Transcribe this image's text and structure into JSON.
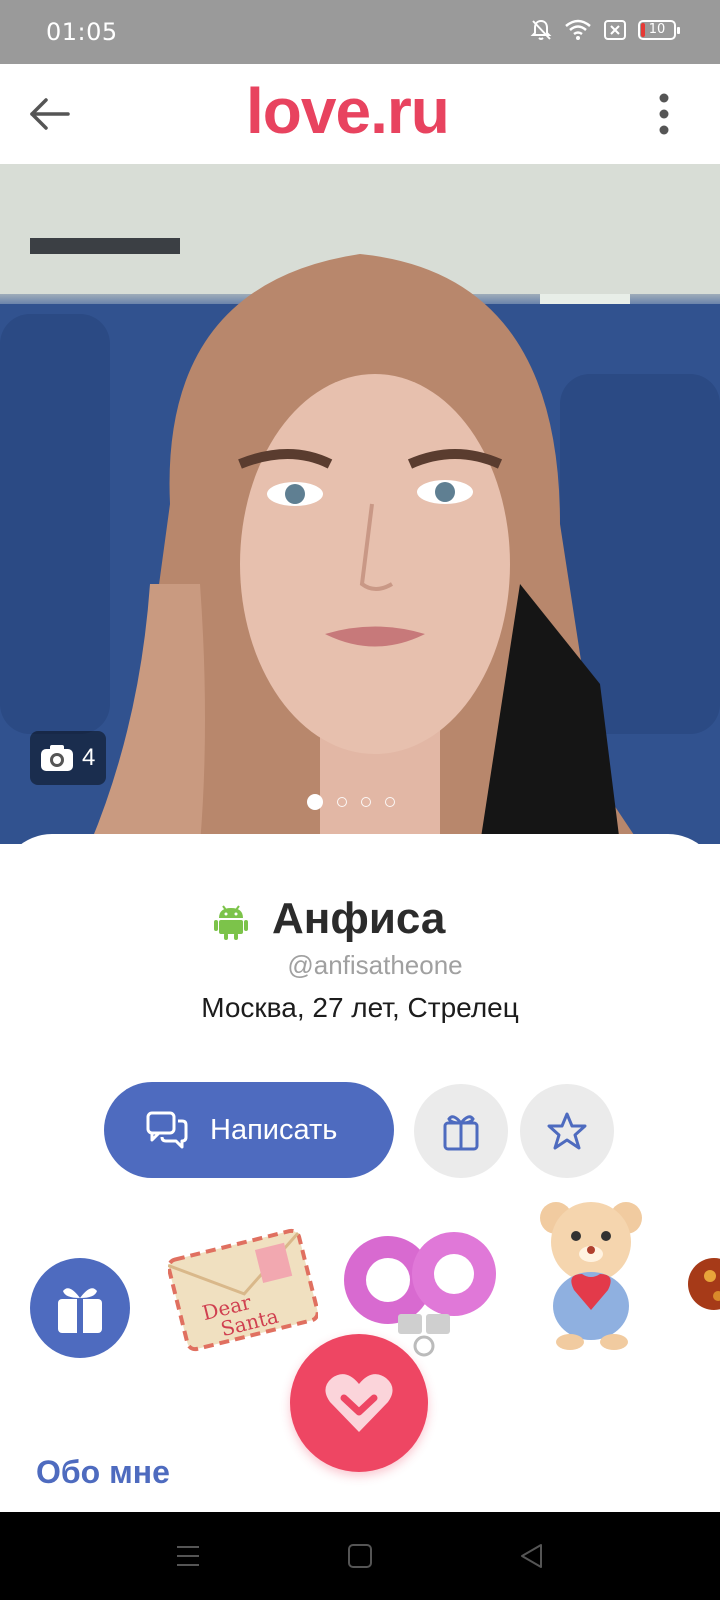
{
  "status_bar": {
    "time": "01:05",
    "battery": "10",
    "icons": [
      "bell-off-icon",
      "wifi-icon",
      "sim-off-icon",
      "battery-icon"
    ]
  },
  "header": {
    "logo": "love.ru",
    "brand_color": "#e8435f"
  },
  "photo": {
    "count": "4",
    "pages": 4,
    "active_page": 1
  },
  "profile": {
    "name": "Анфиса",
    "username": "@anfisatheone",
    "location": "Москва, 27 лет, Стрелец",
    "platform_icon": "android-icon"
  },
  "actions": {
    "write_label": "Написать",
    "accent_color": "#4e6bbf",
    "like_color": "#ee4663"
  },
  "gifts": [
    "envelope-gift",
    "handcuffs-gift",
    "teddy-bear-gift",
    "candy-gift"
  ],
  "sections": {
    "about_title": "Обо мне"
  }
}
